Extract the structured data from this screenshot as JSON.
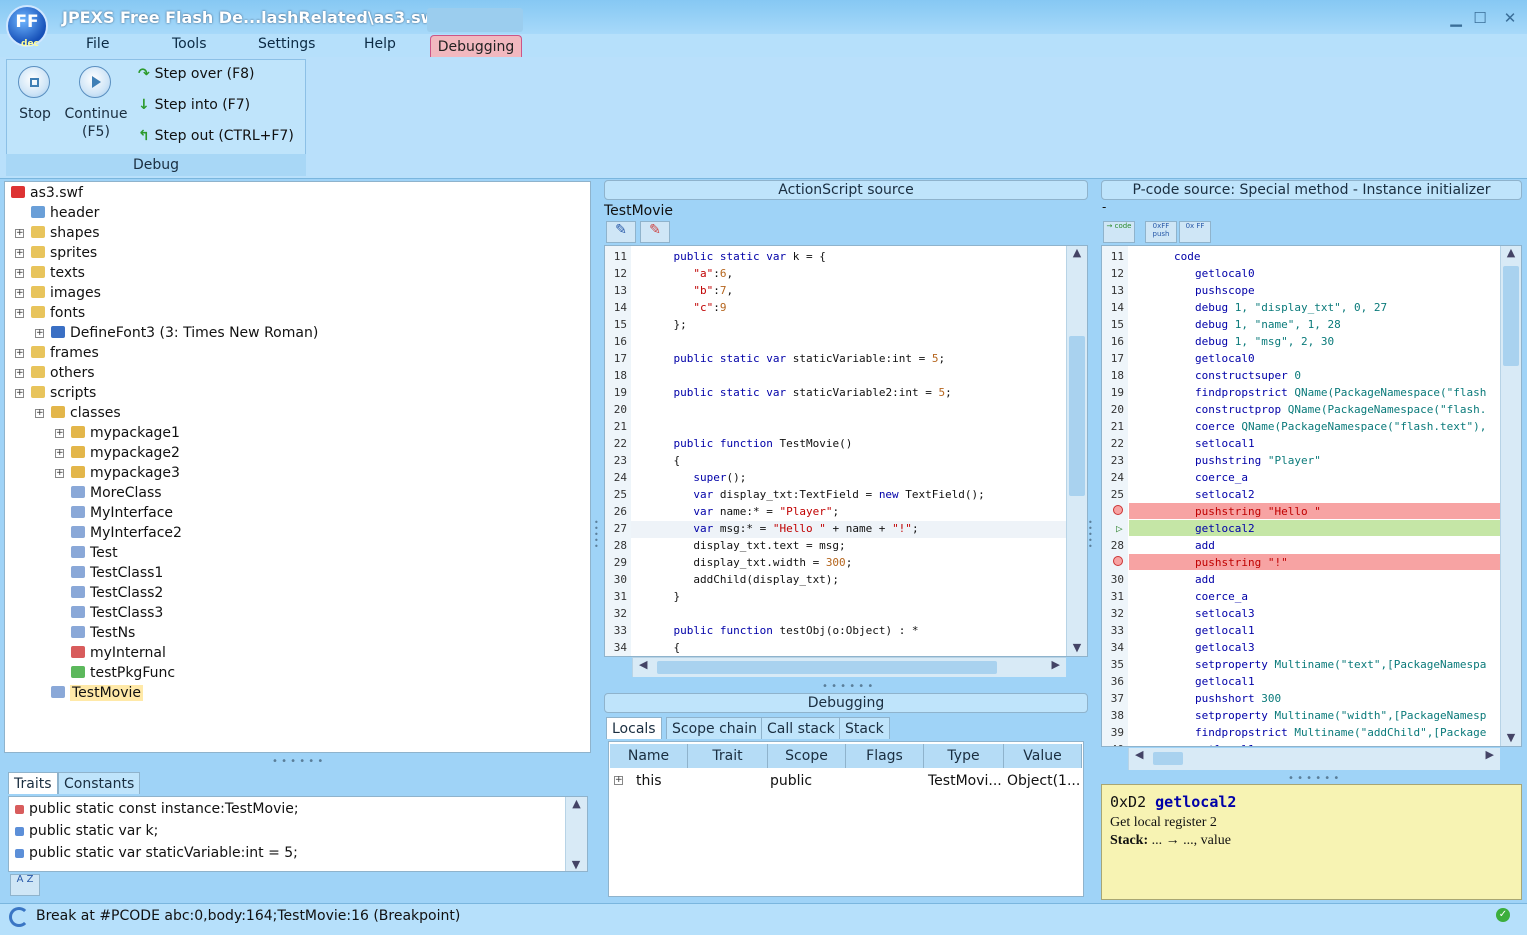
{
  "app": {
    "title": "JPEXS Free Flash De...lashRelated\\as3.swf",
    "logo": "FF",
    "logo_sub": "dec"
  },
  "window": {
    "minimize": "▁",
    "maximize": "☐",
    "close": "✕"
  },
  "menu": {
    "file": "File",
    "tools": "Tools",
    "settings": "Settings",
    "help": "Help",
    "debugging": "Debugging"
  },
  "ribbon": {
    "stop": "Stop",
    "continue": "Continue",
    "continue_key": "(F5)",
    "step_over": "Step over (F8)",
    "step_into": "Step into (F7)",
    "step_out": "Step out (CTRL+F7)",
    "group": "Debug"
  },
  "tree": [
    "as3.swf",
    "header",
    "shapes",
    "sprites",
    "texts",
    "images",
    "fonts",
    "DefineFont3 (3: Times New Roman)",
    "frames",
    "others",
    "scripts",
    "classes",
    "mypackage1",
    "mypackage2",
    "mypackage3",
    "MoreClass",
    "MyInterface",
    "MyInterface2",
    "Test",
    "TestClass1",
    "TestClass2",
    "TestClass3",
    "TestNs",
    "myInternal",
    "testPkgFunc",
    "TestMovie"
  ],
  "traits": {
    "tab1": "Traits",
    "tab2": "Constants",
    "items": [
      "public static const instance:TestMovie;",
      "public static var k;",
      "public static var staticVariable:int = 5;"
    ],
    "sort": "A Z"
  },
  "as": {
    "header": "ActionScript source",
    "class": "TestMovie",
    "lines": [
      {
        "n": "11",
        "t": "    public static var k = {"
      },
      {
        "n": "12",
        "t": "       \"a\":6,"
      },
      {
        "n": "13",
        "t": "       \"b\":7,"
      },
      {
        "n": "14",
        "t": "       \"c\":9"
      },
      {
        "n": "15",
        "t": "    };"
      },
      {
        "n": "16",
        "t": ""
      },
      {
        "n": "17",
        "t": "    public static var staticVariable:int = 5;"
      },
      {
        "n": "18",
        "t": ""
      },
      {
        "n": "19",
        "t": "    public static var staticVariable2:int = 5;"
      },
      {
        "n": "20",
        "t": ""
      },
      {
        "n": "21",
        "t": ""
      },
      {
        "n": "22",
        "t": "    public function TestMovie()"
      },
      {
        "n": "23",
        "t": "    {"
      },
      {
        "n": "24",
        "t": "       super();"
      },
      {
        "n": "25",
        "t": "       var display_txt:TextField = new TextField();"
      },
      {
        "n": "26",
        "t": "       var name:* = \"Player\";"
      },
      {
        "n": "27",
        "t": "       var msg:* = \"Hello \" + name + \"!\";"
      },
      {
        "n": "28",
        "t": "       display_txt.text = msg;"
      },
      {
        "n": "29",
        "t": "       display_txt.width = 300;"
      },
      {
        "n": "30",
        "t": "       addChild(display_txt);"
      },
      {
        "n": "31",
        "t": "    }"
      },
      {
        "n": "32",
        "t": ""
      },
      {
        "n": "33",
        "t": "    public function testObj(o:Object) : *"
      },
      {
        "n": "34",
        "t": "    {"
      }
    ]
  },
  "pcode": {
    "header": "P-code source: Special method - Instance initializer",
    "dash": "-",
    "btn1": "→ code",
    "btn2": "0xFF push",
    "btn3": "0x FF",
    "lines": [
      {
        "n": "11",
        "op": "code",
        "ar": ""
      },
      {
        "n": "12",
        "op": "getlocal0",
        "ar": ""
      },
      {
        "n": "13",
        "op": "pushscope",
        "ar": ""
      },
      {
        "n": "14",
        "op": "debug",
        "ar": "1, \"display_txt\", 0, 27"
      },
      {
        "n": "15",
        "op": "debug",
        "ar": "1, \"name\", 1, 28"
      },
      {
        "n": "16",
        "op": "debug",
        "ar": "1, \"msg\", 2, 30"
      },
      {
        "n": "17",
        "op": "getlocal0",
        "ar": ""
      },
      {
        "n": "18",
        "op": "constructsuper",
        "ar": "0"
      },
      {
        "n": "19",
        "op": "findpropstrict",
        "ar": "QName(PackageNamespace(\"flash"
      },
      {
        "n": "20",
        "op": "constructprop",
        "ar": "QName(PackageNamespace(\"flash."
      },
      {
        "n": "21",
        "op": "coerce",
        "ar": "QName(PackageNamespace(\"flash.text\"),"
      },
      {
        "n": "22",
        "op": "setlocal1",
        "ar": ""
      },
      {
        "n": "23",
        "op": "pushstring",
        "ar": "\"Player\""
      },
      {
        "n": "24",
        "op": "coerce_a",
        "ar": ""
      },
      {
        "n": "25",
        "op": "setlocal2",
        "ar": ""
      },
      {
        "n": "",
        "op": "pushstring",
        "ar": "\"Hello \""
      },
      {
        "n": "",
        "op": "getlocal2",
        "ar": ""
      },
      {
        "n": "28",
        "op": "add",
        "ar": ""
      },
      {
        "n": "",
        "op": "pushstring",
        "ar": "\"!\""
      },
      {
        "n": "30",
        "op": "add",
        "ar": ""
      },
      {
        "n": "31",
        "op": "coerce_a",
        "ar": ""
      },
      {
        "n": "32",
        "op": "setlocal3",
        "ar": ""
      },
      {
        "n": "33",
        "op": "getlocal1",
        "ar": ""
      },
      {
        "n": "34",
        "op": "getlocal3",
        "ar": ""
      },
      {
        "n": "35",
        "op": "setproperty",
        "ar": "Multiname(\"text\",[PackageNamespa"
      },
      {
        "n": "36",
        "op": "getlocal1",
        "ar": ""
      },
      {
        "n": "37",
        "op": "pushshort",
        "ar": "300"
      },
      {
        "n": "38",
        "op": "setproperty",
        "ar": "Multiname(\"width\",[PackageNamesp"
      },
      {
        "n": "39",
        "op": "findpropstrict",
        "ar": "Multiname(\"addChild\",[Package"
      },
      {
        "n": "40",
        "op": "getlocal1",
        "ar": ""
      }
    ]
  },
  "debugging": {
    "header": "Debugging",
    "tabs": [
      "Locals",
      "Scope chain",
      "Call stack",
      "Stack"
    ],
    "cols": [
      "Name",
      "Trait",
      "Scope",
      "Flags",
      "Type",
      "Value"
    ],
    "row": {
      "name": "this",
      "trait": "",
      "scope": "public",
      "flags": "",
      "type": "TestMovi...",
      "value": "Object(1..."
    }
  },
  "doc": {
    "opcode": "0xD2",
    "name": "getlocal2",
    "desc": "Get local register 2",
    "stack_label": "Stack:",
    "stack": "... → ..., value"
  },
  "status": {
    "text": "Break at #PCODE abc:0,body:164;TestMovie:16 (Breakpoint)"
  },
  "colors": {
    "breakpoint": "#f7a3a3",
    "current": "#c5e6a6",
    "selected": "#ffe9a8"
  }
}
